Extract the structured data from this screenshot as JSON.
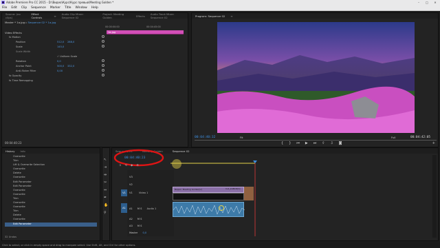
{
  "window": {
    "title": "Adobe Premiere Pro CC 2015 - D:\\Видео\\Курс\\Курс превью\\Meeting Golden *"
  },
  "menu": [
    "File",
    "Edit",
    "Clip",
    "Sequence",
    "Marker",
    "Title",
    "Window",
    "Help"
  ],
  "window_buttons": [
    "–",
    "□",
    "✕"
  ],
  "source_panel": {
    "tabs": [
      "Source: (no clips)",
      "Effect Controls",
      "Audio Clip Mixer: Sequence 02",
      "Project: Meeting Golden",
      "Effects",
      "Audio Track Mixer: Sequence 02"
    ],
    "active_tab": "Effect Controls",
    "master_label": "Master * 1a.jpg",
    "sequence_label": "Sequence 02 * 1a.jpg",
    "timeline_start": "00:00:00:00",
    "timeline_end": "00:04:45:00",
    "clip_label": "1a.jpg",
    "section_video": "Video Effects",
    "section_audio": "Audio Effects",
    "props": [
      {
        "name": "fx  Motion",
        "value": ""
      },
      {
        "name": "Position",
        "value": "512,0",
        "value2": "288,0"
      },
      {
        "name": "Scale",
        "value": "145,0",
        "value2": ""
      },
      {
        "name": "Scale Width",
        "value": "",
        "value2": ""
      },
      {
        "name": "",
        "value": "✓ Uniform Scale",
        "value2": ""
      },
      {
        "name": "Rotation",
        "value": "0,0",
        "value2": ""
      },
      {
        "name": "Anchor Point",
        "value": "500,0",
        "value2": "332,0"
      },
      {
        "name": "Anti-flicker Filter",
        "value": "0,00",
        "value2": ""
      },
      {
        "name": "fx  Opacity",
        "value": ""
      },
      {
        "name": "fx  Time Remapping",
        "value": ""
      }
    ],
    "footer_timecode": "00:04:40:23"
  },
  "program_monitor": {
    "title": "Program: Sequence 02",
    "timecode_left": "00:04:40:32",
    "fit": "Fit",
    "quality": "Full",
    "timecode_right": "00:04:42:05"
  },
  "history_panel": {
    "tabs": [
      "History",
      "Info"
    ],
    "items": [
      "Overwrite",
      "Trim",
      "Lift & Overwrite Selection",
      "Overwrite",
      "Delete",
      "Overwrite",
      "Edit Parameter",
      "Edit Parameter",
      "Overwrite",
      "Overwrite",
      "Trim",
      "Overwrite",
      "Overwrite",
      "Trim",
      "Delete",
      "Overwrite",
      "Edit Parameter"
    ],
    "footer": "32 Undos"
  },
  "timeline": {
    "tabs": [
      "Sequence 01",
      "Meeting Golden",
      "Sequence 02"
    ],
    "active_tab": "Sequence 02",
    "timecode": "00:04:40:23",
    "tracks": [
      {
        "id": "V3",
        "label": ""
      },
      {
        "id": "V2",
        "label": ""
      },
      {
        "id": "V1",
        "label": "Video 1"
      },
      {
        "id": "A1",
        "label": "Audio 1"
      },
      {
        "id": "A2",
        "label": ""
      },
      {
        "id": "A3",
        "label": ""
      }
    ],
    "master_label": "Master",
    "master_value": "0,0",
    "clip_v1_label": "Видео. Meeting Golden[V]",
    "clip_v1_label_b": "Cut_2ABCD[V]"
  },
  "status_text": "Click to select, or click in empty space and drag to marquee select. Use Shift, Alt, and Ctrl for other options.",
  "colors": {
    "accent_blue": "#3d8fe0",
    "annotation_red": "#e01414",
    "cursor_yellow": "#e6d34a",
    "playhead_red": "#e23b3b",
    "tab_pink": "#d24fb7"
  }
}
